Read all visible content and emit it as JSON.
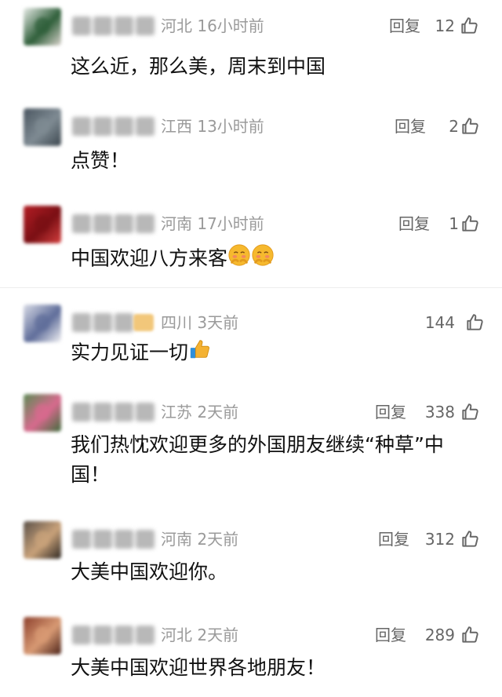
{
  "comments": [
    {
      "region": "河北",
      "time": "16小时前",
      "reply_label": "回复",
      "likes": "12",
      "text": "这么近，那么美，周末到中国",
      "avatar_colors": [
        "#e8ece8",
        "#2f5f3a",
        "#d9d3cc"
      ]
    },
    {
      "region": "江西",
      "time": "13小时前",
      "reply_label": "回复",
      "likes": "2",
      "text": "点赞！",
      "avatar_colors": [
        "#4a5560",
        "#7f8b93",
        "#3c474f"
      ]
    },
    {
      "region": "河南",
      "time": "17小时前",
      "reply_label": "回复",
      "likes": "1",
      "text": "中国欢迎八方来客",
      "emoji": [
        "shy-face-emoji",
        "shy-face-emoji"
      ],
      "avatar_colors": [
        "#b31d24",
        "#7a0f14",
        "#d43f3f"
      ]
    },
    {
      "region": "四川",
      "time": "3天前",
      "likes": "144",
      "text": "实力见证一切",
      "emoji": [
        "thumbs-up-emoji"
      ],
      "avatar_colors": [
        "#d8dbe6",
        "#5f6d9a",
        "#f3f3f5"
      ]
    },
    {
      "region": "江苏",
      "time": "2天前",
      "reply_label": "回复",
      "likes": "338",
      "text": "我们热忱欢迎更多的外国朋友继续“种草”中\n国！",
      "avatar_colors": [
        "#5c8b55",
        "#d86a8e",
        "#3f6d3c"
      ]
    },
    {
      "region": "河南",
      "time": "2天前",
      "reply_label": "回复",
      "likes": "312",
      "text": "大美中国欢迎你。",
      "avatar_colors": [
        "#5a5048",
        "#c9a27a",
        "#2d2722"
      ]
    },
    {
      "region": "河北",
      "time": "2天前",
      "reply_label": "回复",
      "likes": "289",
      "text": "大美中国欢迎世界各地朋友！",
      "avatar_colors": [
        "#8c3f2c",
        "#d89a74",
        "#4b2218"
      ]
    }
  ]
}
